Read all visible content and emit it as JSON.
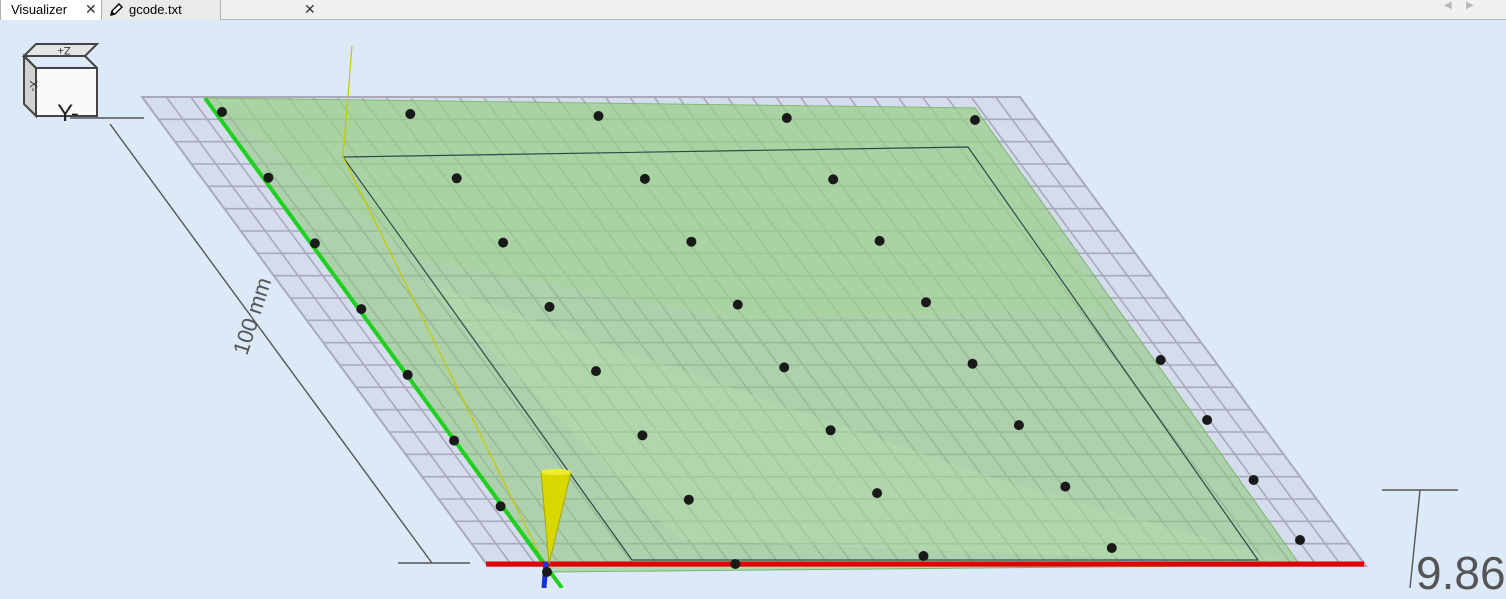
{
  "tabs": [
    {
      "label": "Visualizer",
      "close": "✕",
      "icon": null,
      "active": true
    },
    {
      "label": "gcode.txt",
      "close": "✕",
      "icon": "pencil-icon",
      "active": false
    }
  ],
  "tab_nav": {
    "prev": "◀",
    "next": "▶"
  },
  "view_cube": {
    "front_label": "Y-",
    "top_label": "Z+",
    "side_label": "X-"
  },
  "dimension_label": "100 mm",
  "height_readout": "9.86",
  "colors": {
    "background": "#dce9f9",
    "grid_line": "#a9a9b9",
    "grid_fill": "#c9cde0",
    "mesh_fill": "#8cc879",
    "x_axis": "#e00000",
    "y_axis": "#20d020",
    "z_axis": "#1830e0",
    "probe_point": "#1a1a1a",
    "tool_cone": "#d8d800"
  },
  "probe_grid": {
    "rows": 8,
    "cols": 5
  }
}
